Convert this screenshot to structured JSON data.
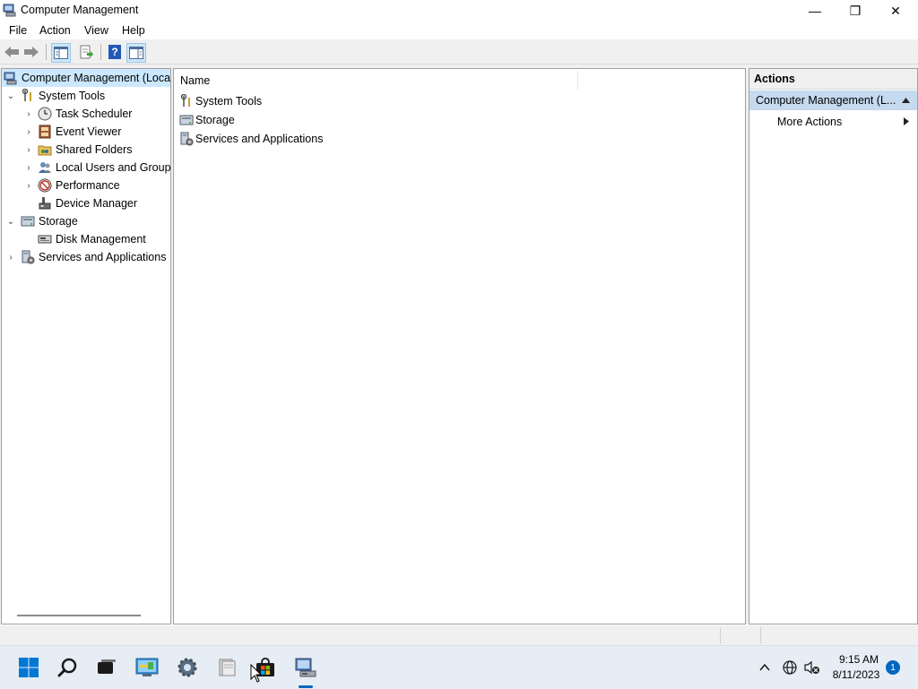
{
  "window": {
    "title": "Computer Management",
    "controls": {
      "minimize": "—",
      "maximize": "❐",
      "close": "✕"
    }
  },
  "menubar": {
    "items": [
      {
        "label": "File"
      },
      {
        "label": "Action"
      },
      {
        "label": "View"
      },
      {
        "label": "Help"
      }
    ]
  },
  "toolbar": {
    "buttons": [
      "back-icon",
      "forward-icon",
      "show-hide-console-tree-icon",
      "export-list-icon",
      "help-icon",
      "show-hide-action-pane-icon"
    ],
    "help_glyph": "?"
  },
  "tree": {
    "root": {
      "label": "Computer Management (Local)"
    },
    "nodes": [
      {
        "label": "System Tools",
        "expanded": true
      },
      {
        "label": "Task Scheduler"
      },
      {
        "label": "Event Viewer"
      },
      {
        "label": "Shared Folders"
      },
      {
        "label": "Local Users and Groups"
      },
      {
        "label": "Performance"
      },
      {
        "label": "Device Manager"
      },
      {
        "label": "Storage",
        "expanded": true
      },
      {
        "label": "Disk Management"
      },
      {
        "label": "Services and Applications",
        "expanded": false
      }
    ]
  },
  "list": {
    "columns": [
      {
        "label": "Name"
      }
    ],
    "rows": [
      {
        "name": "System Tools"
      },
      {
        "name": "Storage"
      },
      {
        "name": "Services and Applications"
      }
    ]
  },
  "actions": {
    "title": "Actions",
    "section": "Computer Management (L...",
    "items": [
      {
        "label": "More Actions"
      }
    ]
  },
  "taskbar": {
    "apps": [
      "start-icon",
      "search-icon",
      "task-view-icon",
      "control-panel-icon",
      "settings-icon",
      "file-explorer-icon",
      "store-icon",
      "computer-management-icon"
    ],
    "clock": {
      "time": "9:15 AM",
      "date": "8/11/2023"
    },
    "notifications": "1"
  },
  "colors": {
    "selection": "#cce8ff",
    "actions_section": "#c5d9ef",
    "accent": "#0067c0"
  }
}
